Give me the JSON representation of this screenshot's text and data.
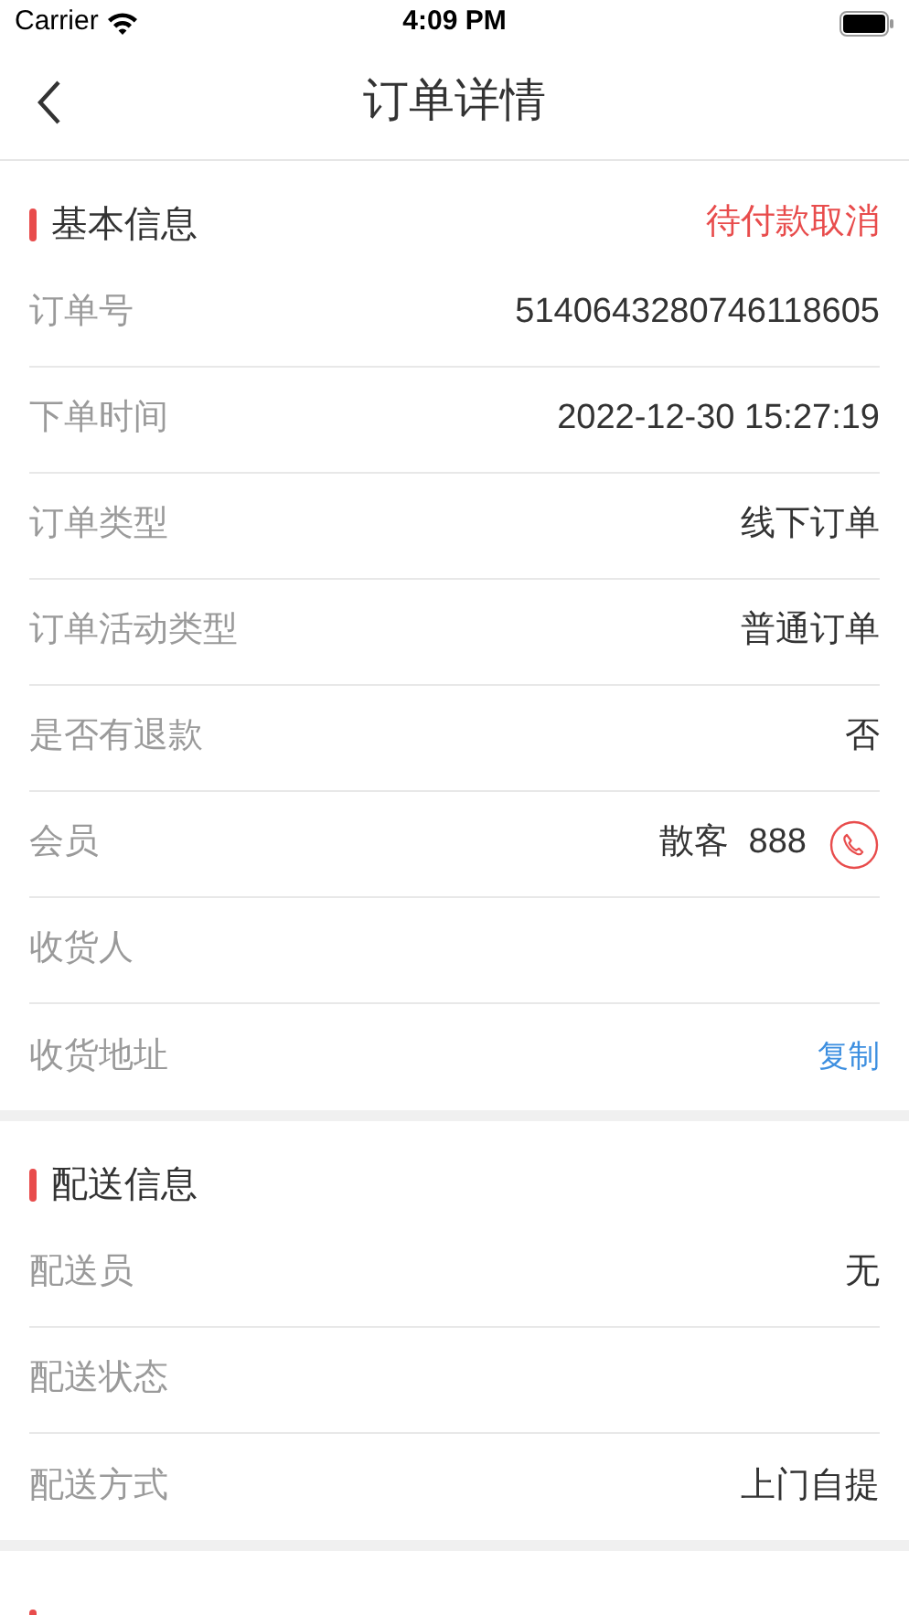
{
  "status_bar": {
    "carrier": "Carrier",
    "time": "4:09 PM"
  },
  "nav": {
    "title": "订单详情"
  },
  "sections": [
    {
      "title": "基本信息",
      "status": "待付款取消",
      "rows": [
        {
          "kind": "text",
          "label": "订单号",
          "value": "5140643280746118605"
        },
        {
          "kind": "text",
          "label": "下单时间",
          "value": "2022-12-30 15:27:19"
        },
        {
          "kind": "text",
          "label": "订单类型",
          "value": "线下订单"
        },
        {
          "kind": "text",
          "label": "订单活动类型",
          "value": "普通订单"
        },
        {
          "kind": "text",
          "label": "是否有退款",
          "value": "否"
        },
        {
          "kind": "phone",
          "label": "会员",
          "value": "散客  888"
        },
        {
          "kind": "text",
          "label": "收货人"
        },
        {
          "kind": "copy",
          "label": "收货地址",
          "action": "复制"
        }
      ]
    },
    {
      "title": "配送信息",
      "rows": [
        {
          "kind": "text",
          "label": "配送员",
          "value": "无"
        },
        {
          "kind": "text",
          "label": "配送状态"
        },
        {
          "kind": "text",
          "label": "配送方式",
          "value": "上门自提"
        }
      ]
    }
  ]
}
